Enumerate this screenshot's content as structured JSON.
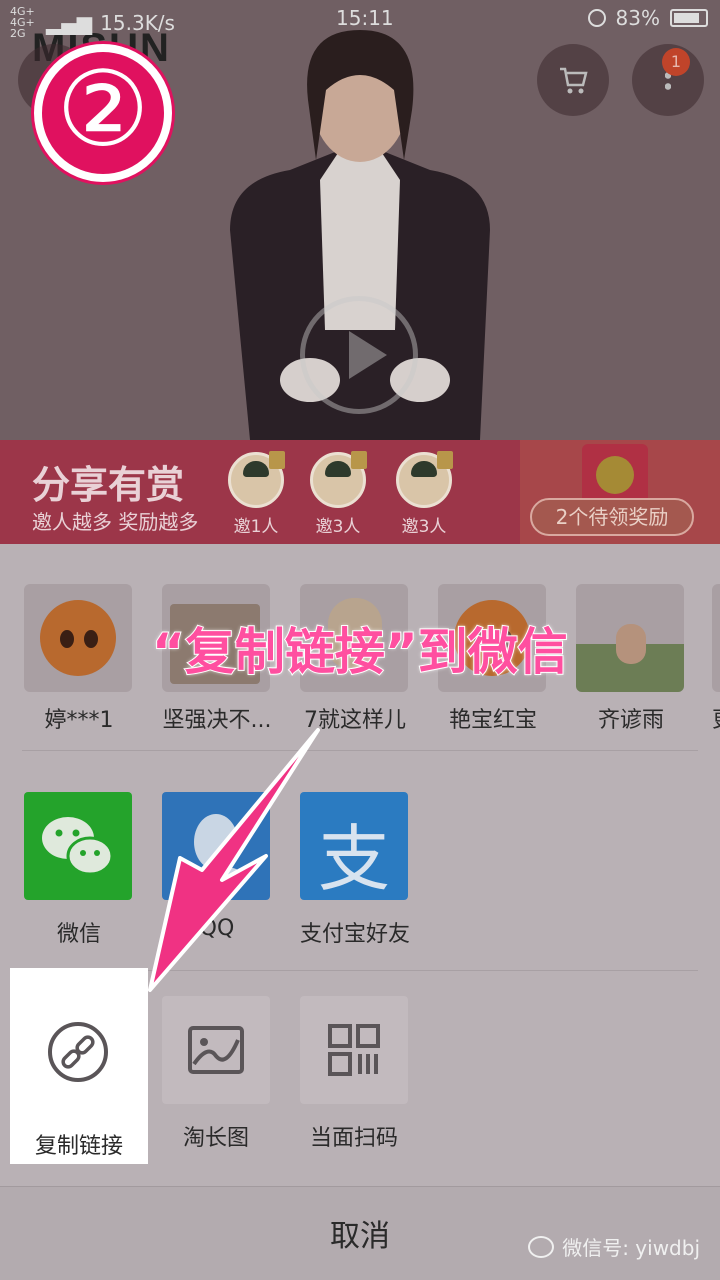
{
  "status_bar": {
    "network_top": "4G+ 4G+",
    "network_bottom": "2G",
    "speed": "15.3K/s",
    "time": "15:11",
    "battery": "83%",
    "battery_level": 0.83
  },
  "hero": {
    "brand": "MISUN",
    "cart_badge": "1",
    "step_number": "②"
  },
  "share_banner": {
    "title": "分享有赏",
    "subtitle": "邀人越多 奖励越多",
    "invites": [
      "邀1人",
      "邀3人",
      "邀3人"
    ],
    "reward_button": "2个待领奖励"
  },
  "contacts": [
    {
      "name": "婷***1"
    },
    {
      "name": "坚强决不..."
    },
    {
      "name": "7就这样儿"
    },
    {
      "name": "艳宝红宝"
    },
    {
      "name": "齐谚雨"
    },
    {
      "name": "更"
    }
  ],
  "apps": [
    {
      "label": "微信",
      "icon": "wechat-icon"
    },
    {
      "label": "QQ",
      "icon": "qq-icon"
    },
    {
      "label": "支付宝好友",
      "icon": "alipay-icon",
      "glyph": "支"
    }
  ],
  "tools": [
    {
      "label": "复制链接",
      "icon": "link-icon"
    },
    {
      "label": "淘长图",
      "icon": "image-icon"
    },
    {
      "label": "当面扫码",
      "icon": "qr-code-icon"
    }
  ],
  "cancel_label": "取消",
  "instruction": "“复制链接”到微信",
  "watermark": "微信号: yiwdbj",
  "colors": {
    "accent": "#e0115f",
    "instruction": "#ff4fa0",
    "wechat": "#24a32b",
    "alipay": "#2b7bc1"
  }
}
